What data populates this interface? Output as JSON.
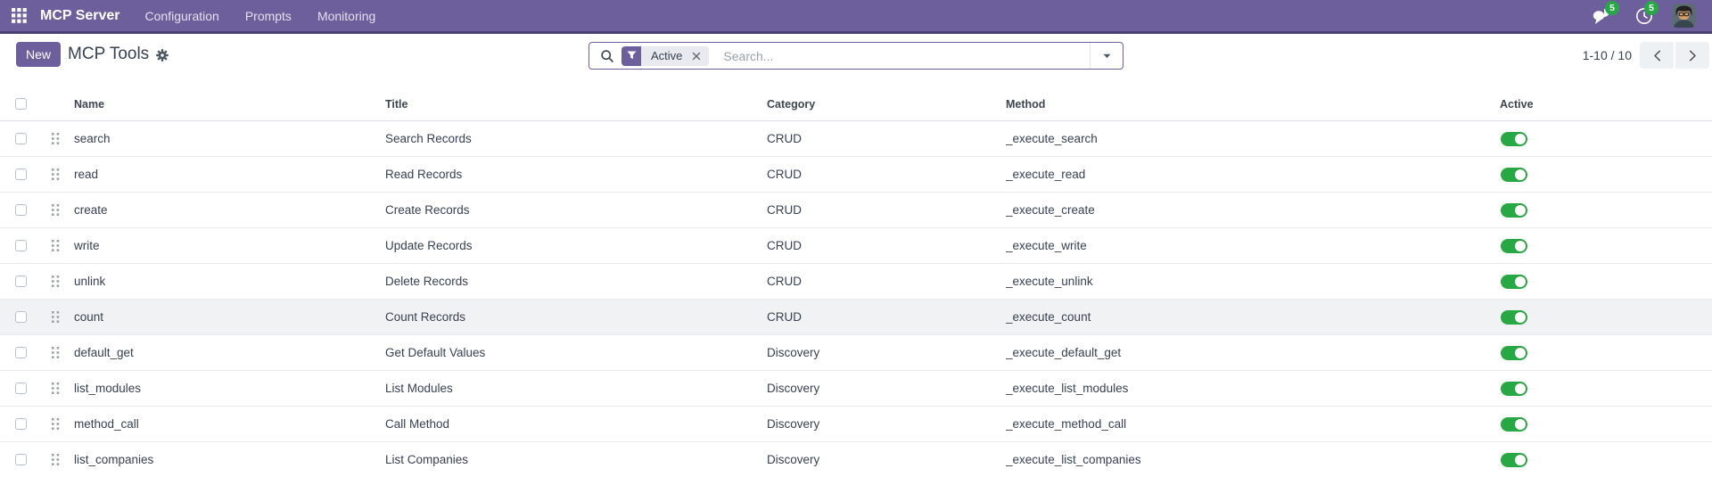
{
  "navbar": {
    "brand": "MCP Server",
    "menus": [
      "Configuration",
      "Prompts",
      "Monitoring"
    ],
    "chat_badge": "5",
    "activity_badge": "5"
  },
  "control_panel": {
    "new_button": "New",
    "title": "MCP Tools",
    "search": {
      "placeholder": "Search...",
      "filter_chip": "Active"
    },
    "pager": {
      "range": "1-10 / 10"
    }
  },
  "table": {
    "columns": [
      "Name",
      "Title",
      "Category",
      "Method",
      "Active"
    ],
    "hover_row_index": 5,
    "rows": [
      {
        "name": "search",
        "title": "Search Records",
        "category": "CRUD",
        "method": "_execute_search",
        "active": true
      },
      {
        "name": "read",
        "title": "Read Records",
        "category": "CRUD",
        "method": "_execute_read",
        "active": true
      },
      {
        "name": "create",
        "title": "Create Records",
        "category": "CRUD",
        "method": "_execute_create",
        "active": true
      },
      {
        "name": "write",
        "title": "Update Records",
        "category": "CRUD",
        "method": "_execute_write",
        "active": true
      },
      {
        "name": "unlink",
        "title": "Delete Records",
        "category": "CRUD",
        "method": "_execute_unlink",
        "active": true
      },
      {
        "name": "count",
        "title": "Count Records",
        "category": "CRUD",
        "method": "_execute_count",
        "active": true
      },
      {
        "name": "default_get",
        "title": "Get Default Values",
        "category": "Discovery",
        "method": "_execute_default_get",
        "active": true
      },
      {
        "name": "list_modules",
        "title": "List Modules",
        "category": "Discovery",
        "method": "_execute_list_modules",
        "active": true
      },
      {
        "name": "method_call",
        "title": "Call Method",
        "category": "Discovery",
        "method": "_execute_method_call",
        "active": true
      },
      {
        "name": "list_companies",
        "title": "List Companies",
        "category": "Discovery",
        "method": "_execute_list_companies",
        "active": true
      }
    ]
  },
  "colors": {
    "primary": "#6C5F9C",
    "toggle_on": "#28a745",
    "badge_green": "#28a745"
  }
}
